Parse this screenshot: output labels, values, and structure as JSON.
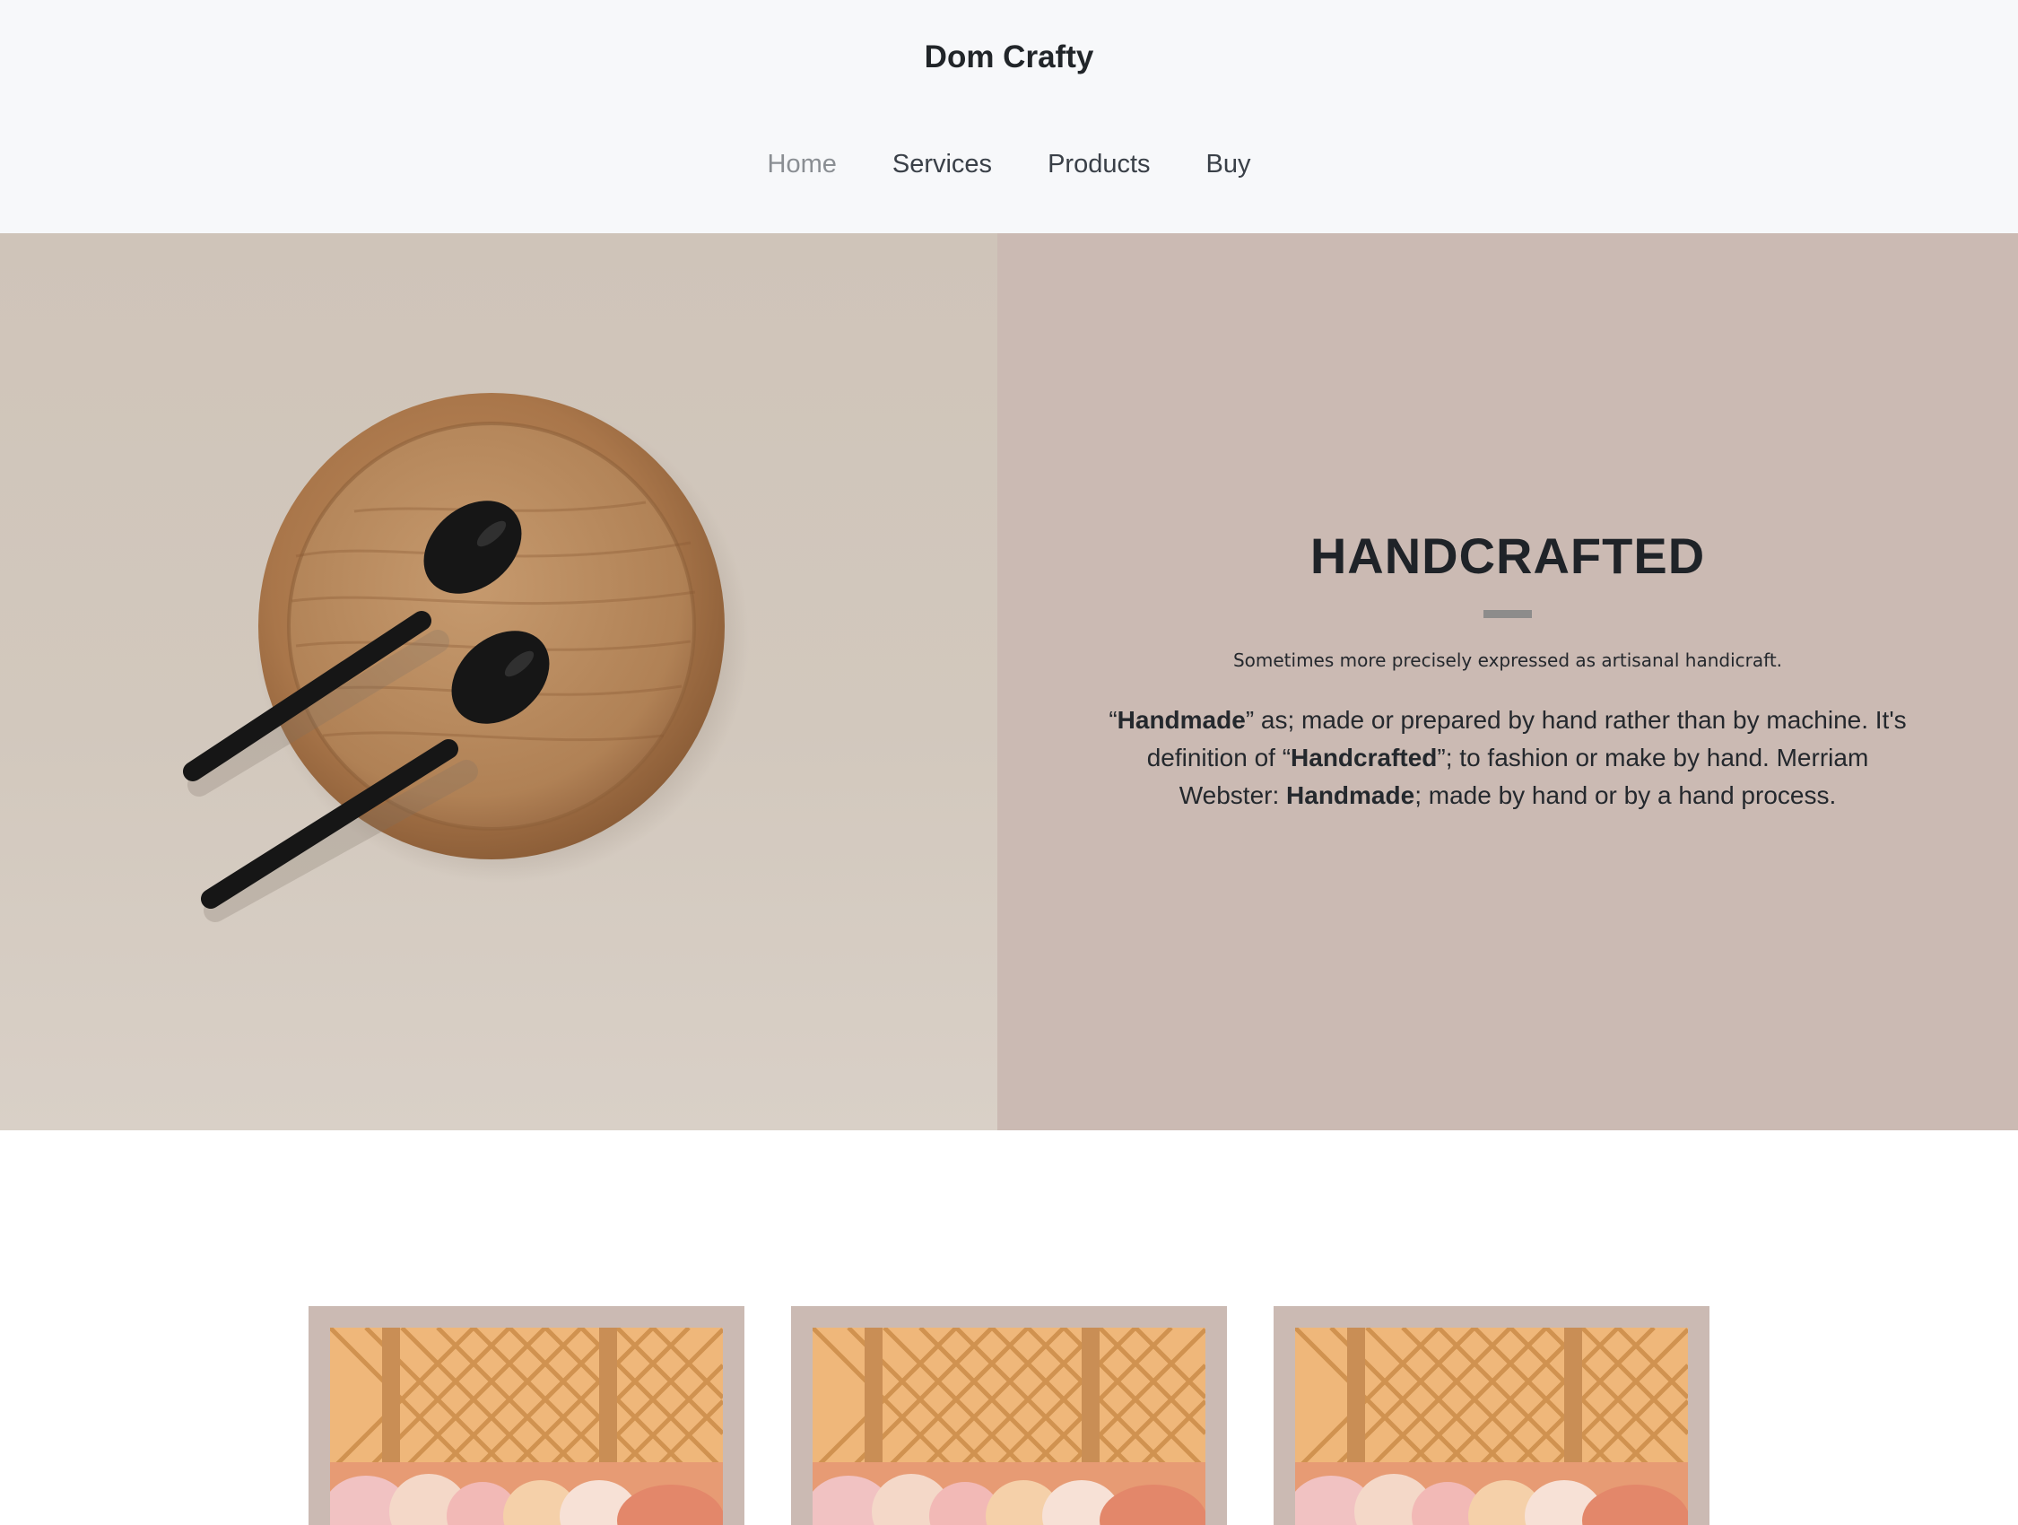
{
  "header": {
    "brand": "Dom Crafty",
    "nav": [
      {
        "label": "Home",
        "active": true
      },
      {
        "label": "Services",
        "active": false
      },
      {
        "label": "Products",
        "active": false
      },
      {
        "label": "Buy",
        "active": false
      }
    ]
  },
  "hero": {
    "image": "wooden-plate-with-black-spoons",
    "title": "HANDCRAFTED",
    "subtitle": "Sometimes more precisely expressed as artisanal handicraft.",
    "body": {
      "q1_open": "“",
      "q1_word": "Handmade",
      "q1_rest": "” as; made or prepared by hand rather than by machine. It's definition of “",
      "q2_word": "Handcrafted",
      "q2_rest": "”; to fashion or make by hand. Merriam Webster: ",
      "q3_word": "Handmade",
      "q3_rest": "; made by hand or by a hand process."
    },
    "colors": {
      "panel": "#cbbab3",
      "divider": "#8d8c8b"
    }
  },
  "products": {
    "cards": [
      {
        "image": "wicker-lattice-cushions-photo"
      },
      {
        "image": "wicker-lattice-cushions-photo"
      },
      {
        "image": "wicker-lattice-cushions-photo"
      }
    ]
  }
}
